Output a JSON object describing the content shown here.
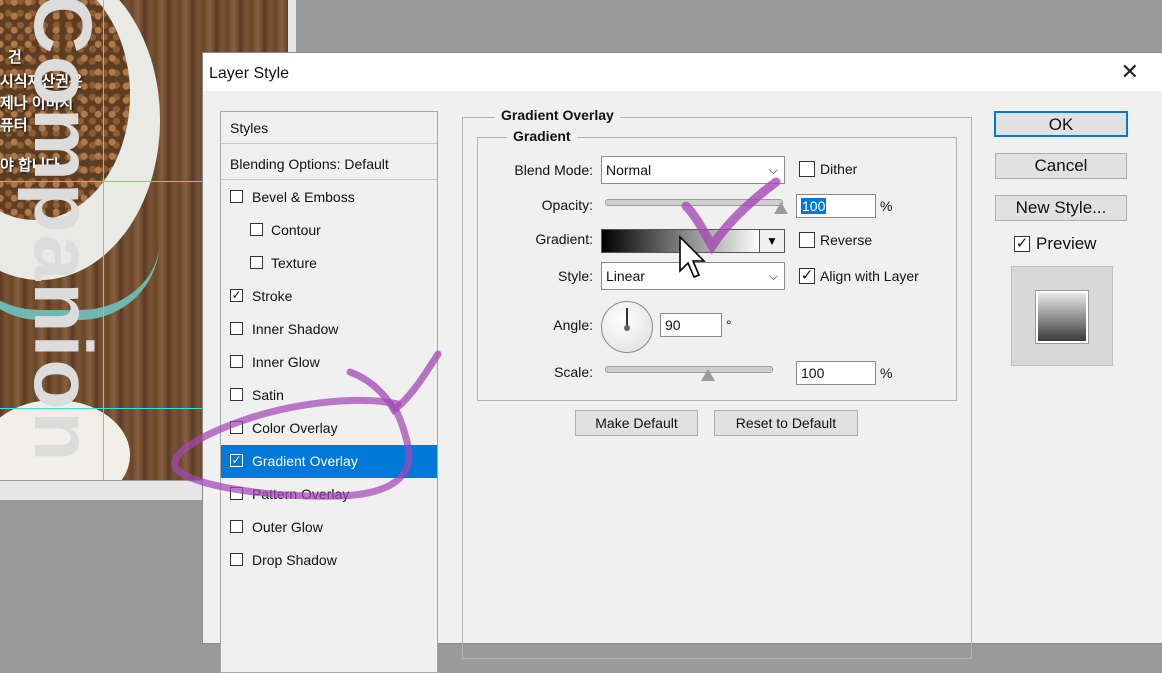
{
  "background": {
    "korean_lines": [
      "건",
      "시식재산권은",
      "제나 이미지",
      "퓨터",
      "야 합니다."
    ],
    "vertical_title": "Companion"
  },
  "dialog": {
    "title": "Layer Style",
    "close_glyph": "✕",
    "styles_list": {
      "header": "Styles",
      "blending_options": "Blending Options: Default",
      "items": [
        {
          "label": "Bevel & Emboss",
          "checked": false,
          "indent": false
        },
        {
          "label": "Contour",
          "checked": false,
          "indent": true
        },
        {
          "label": "Texture",
          "checked": false,
          "indent": true
        },
        {
          "label": "Stroke",
          "checked": true,
          "indent": false
        },
        {
          "label": "Inner Shadow",
          "checked": false,
          "indent": false
        },
        {
          "label": "Inner Glow",
          "checked": false,
          "indent": false
        },
        {
          "label": "Satin",
          "checked": false,
          "indent": false
        },
        {
          "label": "Color Overlay",
          "checked": false,
          "indent": false
        },
        {
          "label": "Gradient Overlay",
          "checked": true,
          "indent": false,
          "selected": true
        },
        {
          "label": "Pattern Overlay",
          "checked": false,
          "indent": false
        },
        {
          "label": "Outer Glow",
          "checked": false,
          "indent": false
        },
        {
          "label": "Drop Shadow",
          "checked": false,
          "indent": false
        }
      ]
    },
    "panel": {
      "section_title": "Gradient Overlay",
      "subsection_title": "Gradient",
      "blend_mode_label": "Blend Mode:",
      "blend_mode_value": "Normal",
      "dither_label": "Dither",
      "dither_checked": false,
      "opacity_label": "Opacity:",
      "opacity_value": "100",
      "opacity_unit": "%",
      "opacity_level": 1.0,
      "gradient_label": "Gradient:",
      "gradient_colors": [
        "#000000",
        "#ffffff"
      ],
      "reverse_label": "Reverse",
      "reverse_checked": false,
      "style_label": "Style:",
      "style_value": "Linear",
      "align_label": "Align with Layer",
      "align_checked": true,
      "angle_label": "Angle:",
      "angle_value": "90",
      "angle_unit": "°",
      "scale_label": "Scale:",
      "scale_value": "100",
      "scale_unit": "%",
      "make_default": "Make Default",
      "reset_default": "Reset to Default"
    },
    "buttons": {
      "ok": "OK",
      "cancel": "Cancel",
      "new_style": "New Style...",
      "preview_label": "Preview",
      "preview_checked": true
    }
  },
  "colors": {
    "selection": "#0078d7",
    "annotation": "#a347b5",
    "guide": "#35e0e6"
  }
}
